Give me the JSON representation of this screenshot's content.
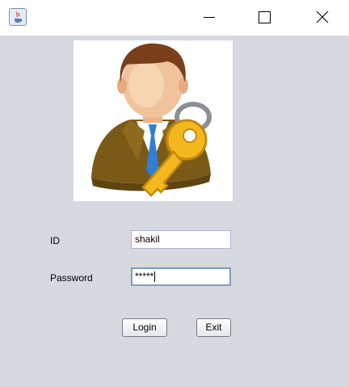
{
  "form": {
    "id_label": "ID",
    "id_value": "shakil",
    "password_label": "Password",
    "password_value": "*****"
  },
  "buttons": {
    "login_label": "Login",
    "exit_label": "Exit"
  },
  "icons": {
    "app": "java-cup-icon",
    "picture": "user-with-key-icon"
  },
  "colors": {
    "background": "#d6d9e0",
    "titlebar": "#ffffff"
  }
}
